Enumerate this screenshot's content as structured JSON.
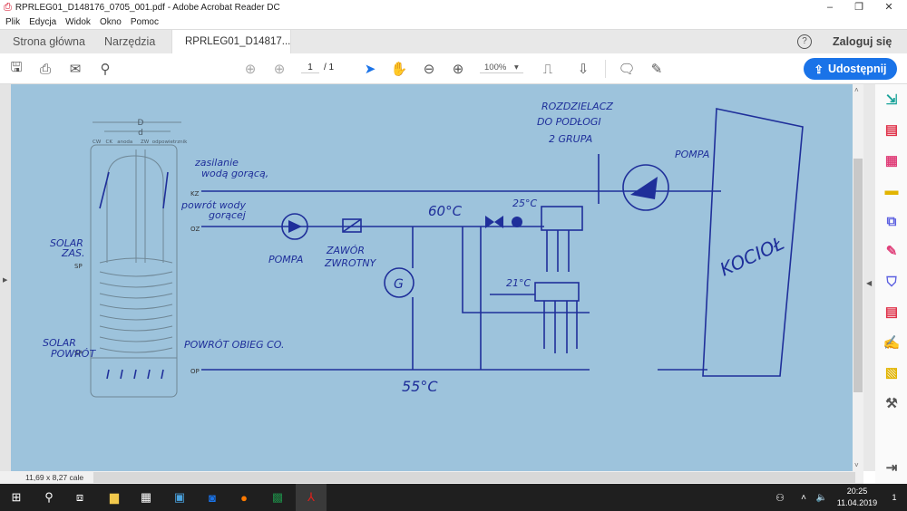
{
  "window": {
    "title": "RPRLEG01_D148176_0705_001.pdf - Adobe Acrobat Reader DC",
    "minimize": "–",
    "restore": "❐",
    "close": "✕"
  },
  "menu": [
    "Plik",
    "Edycja",
    "Widok",
    "Okno",
    "Pomoc"
  ],
  "tabs": {
    "home": "Strona główna",
    "tools": "Narzędzia",
    "document": "RPRLEG01_D14817...",
    "close": "×",
    "help": "?",
    "login": "Zaloguj się"
  },
  "toolbar": {
    "page_current": "1",
    "page_total": "/ 1",
    "zoom": "100%",
    "share": "Udostępnij"
  },
  "status": {
    "page_size": "11,69 x 8,27 cale"
  },
  "taskbar": {
    "time": "20:25",
    "date": "11.04.2019",
    "notifications": "1"
  },
  "drawing": {
    "printed": {
      "D": "D",
      "d": "d",
      "labels": "CW   CK   anoda     ZW  odpowietrznik",
      "kz": "KZ",
      "oz": "OZ",
      "sp1": "SP",
      "sp2": "SP",
      "op": "OP"
    },
    "handwritten": {
      "supply": "zasilanie",
      "supply2": "wodą gorącą,",
      "return": "powrót wody",
      "return2": "gorącej",
      "solar_in": "SOLAR",
      "solar_in2": "ZAS.",
      "solar_out": "SOLAR",
      "solar_out2": "POWRÓT",
      "pump1": "POMPA",
      "valve": "ZAWÓR",
      "valve2": "ZWROTNY",
      "g": "G",
      "t60": "60°C",
      "t25": "25°C",
      "t21": "21°C",
      "t55": "55°C",
      "dist1": "ROZDZIELACZ",
      "dist2": "DO PODŁOGI",
      "dist3": "2 GRUPA",
      "pump2": "POMPA",
      "boiler": "KOCIOŁ",
      "return_co": "POWRÓT OBIEG CO."
    }
  },
  "colors": {
    "accent": "#1a73e8",
    "page": "#9dc3dc",
    "ink": "#1f2f9a"
  }
}
